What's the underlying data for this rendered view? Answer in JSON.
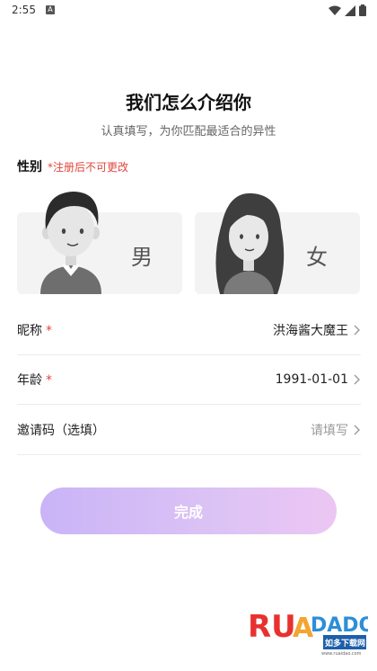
{
  "status_bar": {
    "time": "2:55",
    "notification_letter": "A"
  },
  "header": {
    "title": "我们怎么介绍你",
    "subtitle": "认真填写，为你匹配最适合的异性"
  },
  "gender": {
    "label": "性别",
    "note": "*注册后不可更改",
    "options": [
      {
        "label": "男",
        "icon": "male-avatar-icon"
      },
      {
        "label": "女",
        "icon": "female-avatar-icon"
      }
    ]
  },
  "form": {
    "nickname": {
      "label": "昵称",
      "required_mark": "*",
      "value": "洪海酱大魔王"
    },
    "age": {
      "label": "年龄",
      "required_mark": "*",
      "value": "1991-01-01"
    },
    "invite_code": {
      "label": "邀请码（选填）",
      "placeholder": "请填写"
    }
  },
  "submit": {
    "label": "完成"
  },
  "watermark": {
    "text": "RUANDADO",
    "sub": "如多下载网",
    "url": "www.ruaidao.com"
  },
  "colors": {
    "accent_red": "#e0463c",
    "button_start": "#c9b4f7",
    "button_end": "#ecc6f3"
  }
}
